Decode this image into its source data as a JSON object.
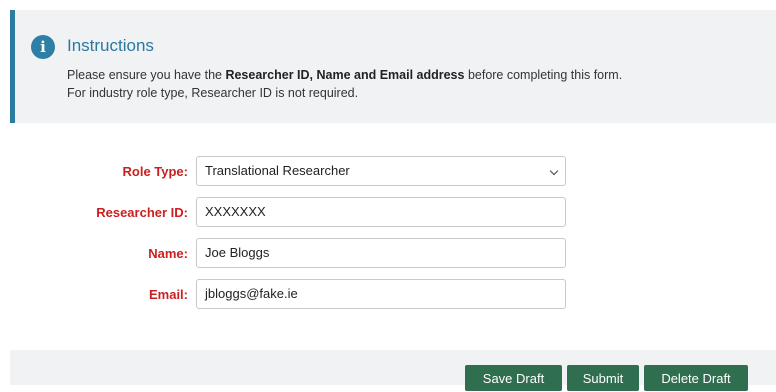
{
  "instructions": {
    "title": "Instructions",
    "line1_prefix": "Please ensure you have the ",
    "line1_bold": "Researcher ID, Name and Email address",
    "line1_suffix": " before completing this form.",
    "line2": "For industry role type, Researcher ID is not required."
  },
  "form": {
    "role_type": {
      "label": "Role Type:",
      "value": "Translational Researcher"
    },
    "researcher_id": {
      "label": "Researcher ID:",
      "value": "XXXXXXX"
    },
    "name": {
      "label": "Name:",
      "value": "Joe Bloggs"
    },
    "email": {
      "label": "Email:",
      "value": "jbloggs@fake.ie"
    }
  },
  "actions": {
    "save_draft": "Save Draft",
    "submit": "Submit",
    "delete_draft": "Delete Draft"
  },
  "colors": {
    "accent_blue": "#2c7ba1",
    "label_red": "#cc1f1f",
    "button_green": "#2f6e4e",
    "panel_gray": "#f1f2f4"
  }
}
